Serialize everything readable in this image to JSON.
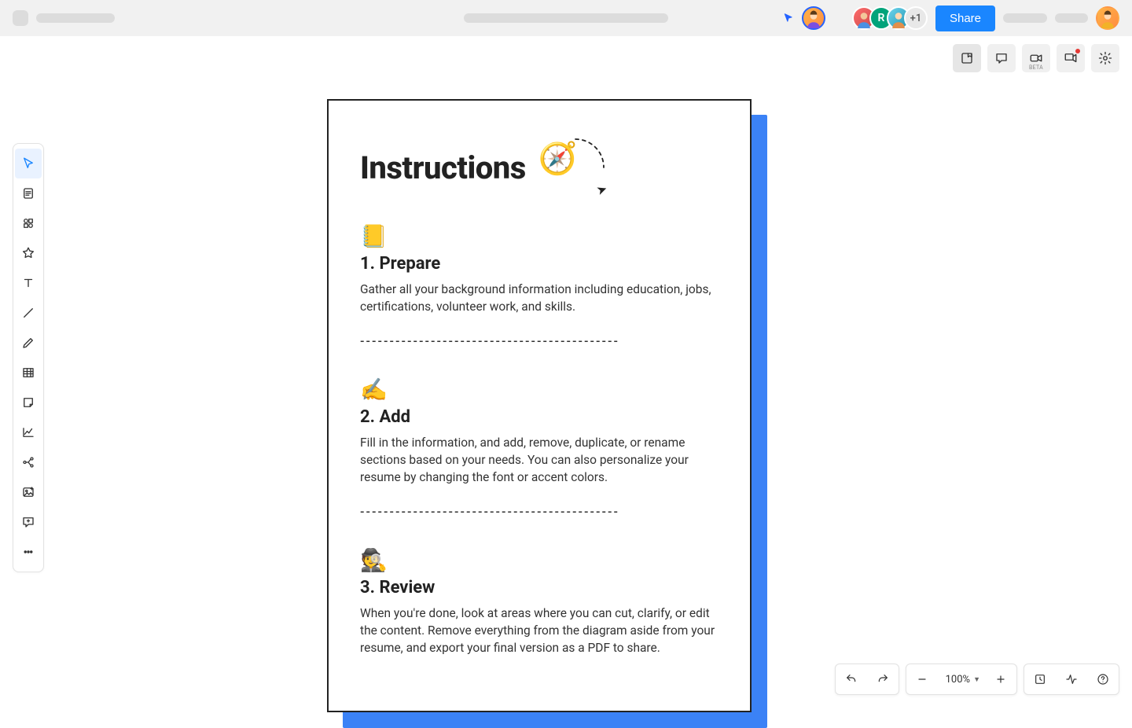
{
  "topbar": {
    "share_label": "Share",
    "extra_avatars": "+1"
  },
  "zoom": {
    "level": "100%"
  },
  "right_tools_beta": "BETA",
  "document": {
    "title": "Instructions",
    "dashes": "--------------------------------------------",
    "steps": [
      {
        "emoji": "📒",
        "heading": "1. Prepare",
        "body": "Gather all your background information including education, jobs, certifications, volunteer work, and skills."
      },
      {
        "emoji": "✍️",
        "heading": "2. Add",
        "body": "Fill in the information, and add, remove, duplicate, or rename sections based on your needs. You can also personalize your resume by changing the font or accent colors."
      },
      {
        "emoji": "🕵️",
        "heading": "3. Review",
        "body": "When you're done, look at areas where you can cut, clarify, or edit the content. Remove everything from the diagram aside from your resume, and export your final version as a PDF to share."
      }
    ]
  }
}
